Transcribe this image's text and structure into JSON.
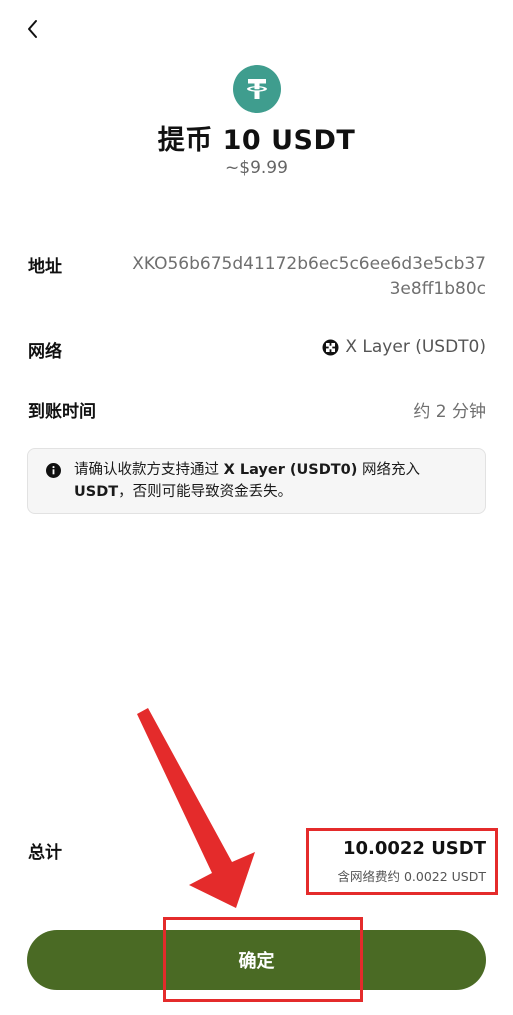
{
  "header": {
    "back_icon": "chevron-left-icon"
  },
  "token": {
    "icon": "tether-usdt-icon",
    "brand_color": "#3f9d8e"
  },
  "title": "提币 10 USDT",
  "fiat_value": "~$9.99",
  "details": {
    "address_label": "地址",
    "address_value": "XKO56b675d41172b6ec5c6ee6d3e5cb373e8ff1b80c",
    "network_label": "网络",
    "network_icon": "x-layer-icon",
    "network_value": "X Layer (USDT0)",
    "arrival_label": "到账时间",
    "arrival_value": "约 2 分钟"
  },
  "notice": {
    "icon": "info-icon",
    "text_1": "请确认收款方支持通过 ",
    "network_bold": "X Layer (USDT0)",
    "text_2": " 网络充入 ",
    "token_bold": "USDT",
    "text_3": "，否则可能导致资金丢失。"
  },
  "total": {
    "label": "总计",
    "amount": "10.0022 USDT",
    "fee_note": "含网络费约 0.0022 USDT"
  },
  "confirm_label": "确定",
  "colors": {
    "button_bg": "#4a6a24",
    "annotation_red": "#e42b2b"
  }
}
